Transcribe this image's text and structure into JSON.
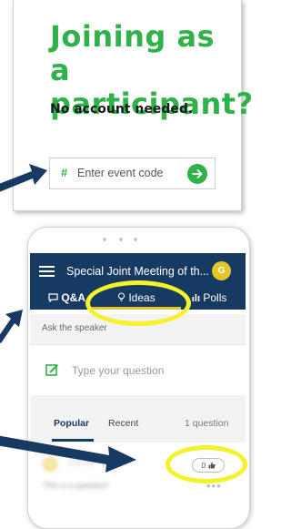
{
  "join": {
    "headline_line1": "Joining as a",
    "headline_line2": "participant?",
    "subhead": "No account needed.",
    "code_prefix": "#",
    "code_placeholder": "Enter event code"
  },
  "event": {
    "title": "Special Joint Meeting of th...",
    "avatar_initial": "G",
    "tabs": [
      {
        "label": "Q&A"
      },
      {
        "label": "Ideas"
      },
      {
        "label": "Polls"
      }
    ]
  },
  "ask": {
    "section_label": "Ask the speaker",
    "input_placeholder": "Type your question"
  },
  "feed": {
    "tab_popular": "Popular",
    "tab_recent": "Recent",
    "count": "1 question",
    "question": {
      "author_initial": "G",
      "time": "2:24 PM",
      "text": "This is a question!",
      "likes": "0",
      "more": "•••"
    }
  },
  "colors": {
    "brand_green": "#2fb24a",
    "nav_blue": "#173a63",
    "accent_yellow": "#e3c72a",
    "highlight_yellow": "#f5f12a",
    "arrow_blue": "#173a63"
  }
}
